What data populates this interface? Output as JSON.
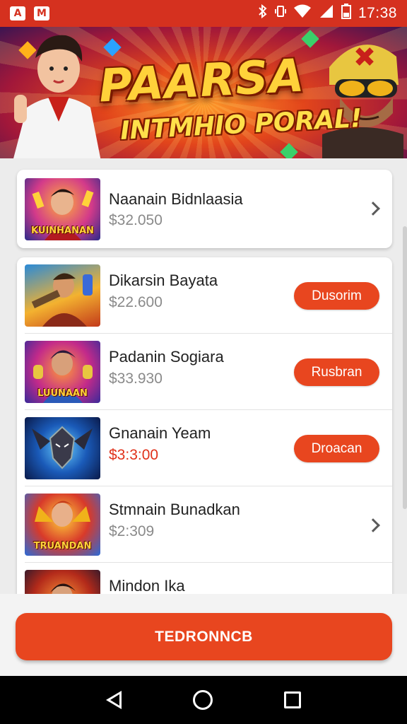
{
  "status_bar": {
    "time": "17:38",
    "icons": [
      "android-app-icon",
      "gmail-icon",
      "bluetooth-icon",
      "vibrate-icon",
      "wifi-icon",
      "signal-icon",
      "battery-icon"
    ]
  },
  "banner": {
    "title": "PAARSA",
    "subtitle": "INTMHIO PORAL!"
  },
  "featured": {
    "name": "Naanain Bidnlaasia",
    "price": "$32.050",
    "thumb_label": "KUINHANAN"
  },
  "items": [
    {
      "name": "Dikarsin Bayata",
      "price": "$22.600",
      "action": "Dusorim",
      "has_action": true,
      "price_red": false,
      "thumb_label": ""
    },
    {
      "name": "Padanin Sogiara",
      "price": "$33.930",
      "action": "Rusbran",
      "has_action": true,
      "price_red": false,
      "thumb_label": "LUUNAAN"
    },
    {
      "name": "Gnanain Yeam",
      "price": "$3:3:00",
      "action": "Droacan",
      "has_action": true,
      "price_red": true,
      "thumb_label": ""
    },
    {
      "name": "Stmnain Bunadkan",
      "price": "$2:309",
      "action": "",
      "has_action": false,
      "price_red": false,
      "thumb_label": "TRUANDAN"
    },
    {
      "name": "Mindon Ika",
      "price": "",
      "action": "",
      "has_action": false,
      "price_red": false,
      "thumb_label": ""
    }
  ],
  "cta": {
    "label": "TEDRONNCB"
  },
  "colors": {
    "accent": "#e8461f",
    "status_bar": "#d5311f",
    "price_red": "#e0311a"
  }
}
